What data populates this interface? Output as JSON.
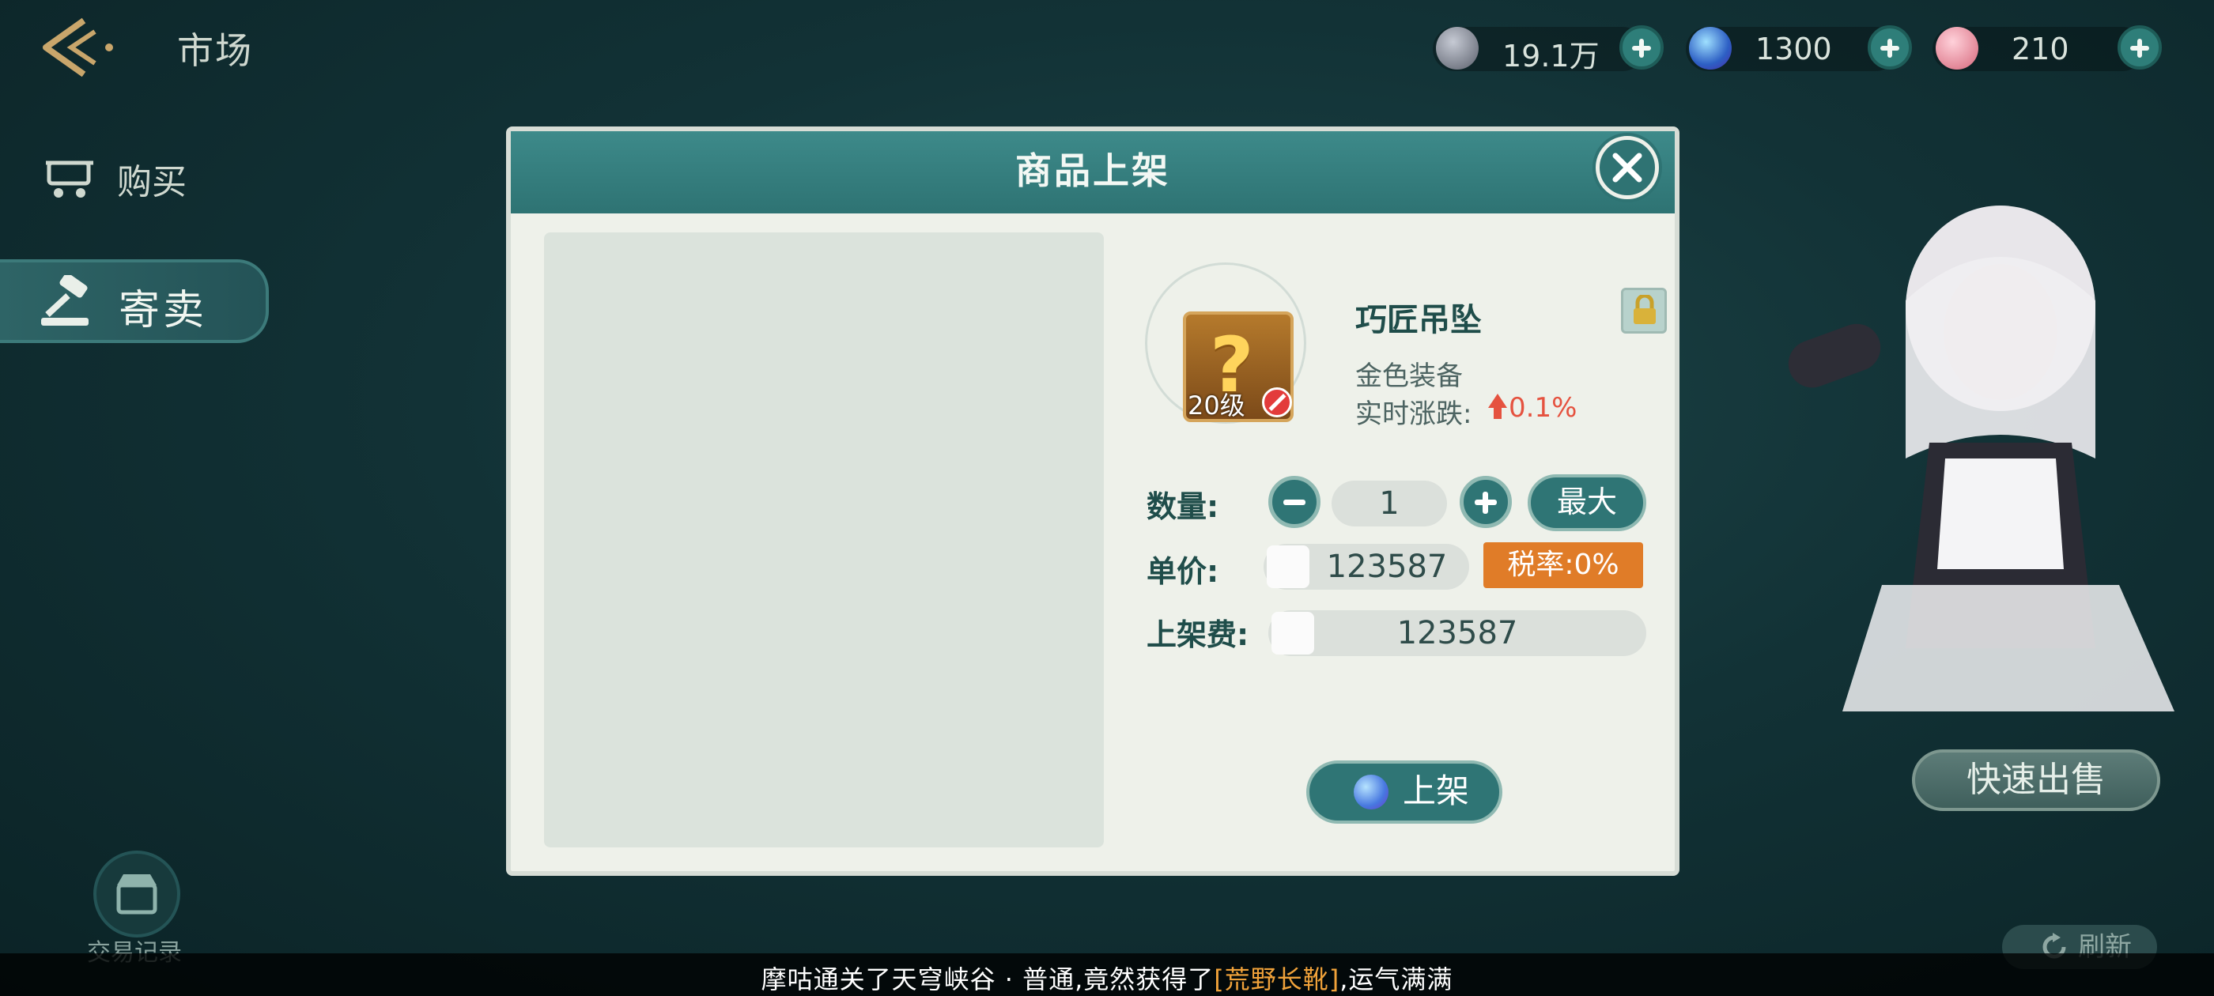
{
  "header": {
    "title": "市场",
    "currencies": [
      {
        "name": "silver-coin-icon",
        "value": "19.1万",
        "color": "#7a7f8c"
      },
      {
        "name": "blue-gem-icon",
        "value": "1300",
        "color": "#3d7fd6"
      },
      {
        "name": "pink-crystal-icon",
        "value": "210",
        "color": "#e07f92"
      }
    ]
  },
  "sidebar": {
    "items": [
      {
        "label": "购买",
        "icon": "cart-icon"
      },
      {
        "label": "寄卖",
        "icon": "gavel-icon"
      }
    ],
    "trade_record": "交易记录"
  },
  "right": {
    "quick_sell": "快速出售",
    "refresh": "刷新"
  },
  "dialog": {
    "title": "商品上架",
    "item": {
      "name": "巧匠吊坠",
      "level": "20级",
      "grade": "金色装备",
      "change_label": "实时涨跌:",
      "change_value": "0.1%"
    },
    "quantity_label": "数量:",
    "quantity": "1",
    "max_label": "最大",
    "price_label": "单价:",
    "price": "123587",
    "tax": "税率:0%",
    "fee_label": "上架费:",
    "fee": "123587",
    "list_button": "上架"
  },
  "ticker": {
    "prefix": "摩咕通关了天穹峡谷 · 普通,竟然获得了",
    "highlight": "[荒野长靴]",
    "suffix": ",运气满满"
  }
}
